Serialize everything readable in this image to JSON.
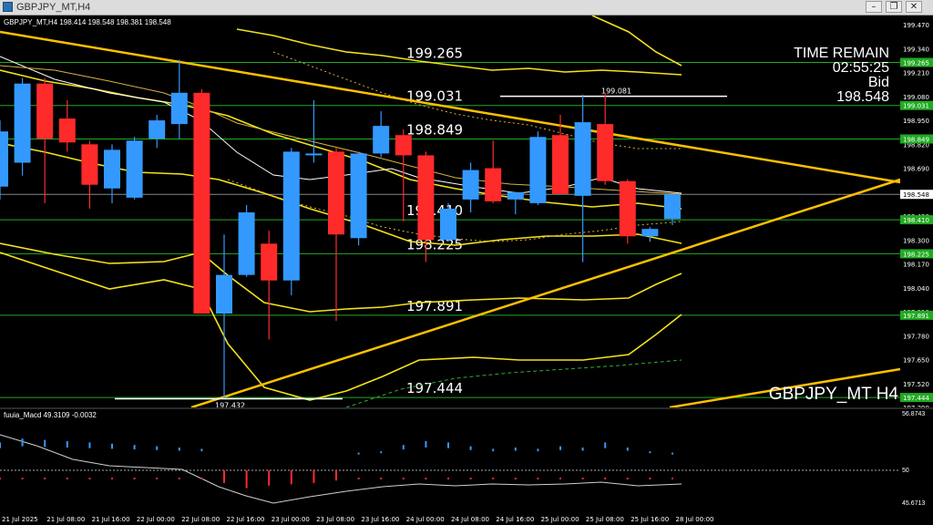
{
  "window": {
    "title": "GBPJPY_MT,H4"
  },
  "chart_header": "GBPJPY_MT,H4  198.414 198.548 198.381 198.548",
  "info": {
    "time_remain_label": "TIME REMAIN",
    "time_remain_value": "02:55:25",
    "bid_label": "Bid",
    "bid_value": "198.548",
    "watermark": "GBPJPY_MT H4"
  },
  "colors": {
    "bull": "#3399ff",
    "bear": "#ff2a2a",
    "level": "#22aa22",
    "trend": "#ffc000",
    "band": "#f3e21a",
    "bg": "#000000"
  },
  "chart_data": {
    "type": "candlestick",
    "y_range": [
      197.39,
      199.52
    ],
    "y_ticks": [
      "199.470",
      "199.340",
      "199.210",
      "199.080",
      "198.950",
      "198.820",
      "198.690",
      "198.560",
      "198.430",
      "198.300",
      "198.170",
      "198.040",
      "197.910",
      "197.780",
      "197.650",
      "197.520",
      "197.390"
    ],
    "level_tags": [
      "199.265",
      "199.031",
      "198.849",
      "198.410",
      "198.225",
      "197.891",
      "197.444"
    ],
    "current_price_tag": "198.548",
    "levels": [
      {
        "label": "199.265",
        "value": 199.265
      },
      {
        "label": "199.031",
        "value": 199.031
      },
      {
        "label": "198.849",
        "value": 198.849
      },
      {
        "label": "198.410",
        "value": 198.41
      },
      {
        "label": "198.225",
        "value": 198.225
      },
      {
        "label": "197.891",
        "value": 197.891
      },
      {
        "label": "197.444",
        "value": 197.444
      }
    ],
    "annotations": [
      {
        "text": "199.081",
        "value": 199.081
      },
      {
        "text": "197.432",
        "value": 197.432
      }
    ],
    "candles": [
      {
        "o": 198.59,
        "h": 198.95,
        "l": 198.52,
        "c": 198.89
      },
      {
        "o": 198.72,
        "h": 199.18,
        "l": 198.65,
        "c": 199.15
      },
      {
        "o": 199.15,
        "h": 199.18,
        "l": 198.5,
        "c": 198.85
      },
      {
        "o": 198.96,
        "h": 199.06,
        "l": 198.78,
        "c": 198.83
      },
      {
        "o": 198.82,
        "h": 198.84,
        "l": 198.47,
        "c": 198.6
      },
      {
        "o": 198.58,
        "h": 198.82,
        "l": 198.5,
        "c": 198.79
      },
      {
        "o": 198.53,
        "h": 198.86,
        "l": 198.52,
        "c": 198.84
      },
      {
        "o": 198.85,
        "h": 198.98,
        "l": 198.8,
        "c": 198.95
      },
      {
        "o": 198.93,
        "h": 199.28,
        "l": 198.85,
        "c": 199.1
      },
      {
        "o": 199.1,
        "h": 199.12,
        "l": 197.9,
        "c": 197.9
      },
      {
        "o": 197.9,
        "h": 198.33,
        "l": 197.44,
        "c": 198.11
      },
      {
        "o": 198.11,
        "h": 198.49,
        "l": 198.1,
        "c": 198.45
      },
      {
        "o": 198.28,
        "h": 198.35,
        "l": 197.76,
        "c": 198.08
      },
      {
        "o": 198.08,
        "h": 198.8,
        "l": 198.0,
        "c": 198.78
      },
      {
        "o": 198.76,
        "h": 199.06,
        "l": 198.72,
        "c": 198.77
      },
      {
        "o": 198.78,
        "h": 198.8,
        "l": 197.86,
        "c": 198.33
      },
      {
        "o": 198.31,
        "h": 198.78,
        "l": 198.27,
        "c": 198.77
      },
      {
        "o": 198.77,
        "h": 199.0,
        "l": 198.75,
        "c": 198.92
      },
      {
        "o": 198.87,
        "h": 198.9,
        "l": 198.4,
        "c": 198.76
      },
      {
        "o": 198.76,
        "h": 198.78,
        "l": 198.18,
        "c": 198.3
      },
      {
        "o": 198.3,
        "h": 198.5,
        "l": 198.29,
        "c": 198.47
      },
      {
        "o": 198.52,
        "h": 198.72,
        "l": 198.45,
        "c": 198.68
      },
      {
        "o": 198.69,
        "h": 198.84,
        "l": 198.5,
        "c": 198.51
      },
      {
        "o": 198.52,
        "h": 198.56,
        "l": 198.44,
        "c": 198.56
      },
      {
        "o": 198.5,
        "h": 198.89,
        "l": 198.49,
        "c": 198.86
      },
      {
        "o": 198.87,
        "h": 198.98,
        "l": 198.55,
        "c": 198.55
      },
      {
        "o": 198.54,
        "h": 199.09,
        "l": 198.18,
        "c": 198.94
      },
      {
        "o": 198.93,
        "h": 199.1,
        "l": 198.6,
        "c": 198.62
      },
      {
        "o": 198.62,
        "h": 198.63,
        "l": 198.28,
        "c": 198.32
      },
      {
        "o": 198.32,
        "h": 198.37,
        "l": 198.29,
        "c": 198.36
      },
      {
        "o": 198.414,
        "h": 198.548,
        "l": 198.381,
        "c": 198.548
      }
    ],
    "x_labels": [
      "21 Jul 2025",
      "21 Jul 08:00",
      "21 Jul 16:00",
      "22 Jul 00:00",
      "22 Jul 08:00",
      "22 Jul 16:00",
      "23 Jul 00:00",
      "23 Jul 08:00",
      "23 Jul 16:00",
      "24 Jul 00:00",
      "24 Jul 08:00",
      "24 Jul 16:00",
      "25 Jul 00:00",
      "25 Jul 08:00",
      "25 Jul 16:00",
      "28 Jul 00:00"
    ]
  },
  "indicator": {
    "label": "fuuia_Macd 49.3109 -0.0032",
    "axis_top": "56.8743",
    "axis_mid": "50",
    "axis_bottom": "45.6713",
    "hist": [
      0.45,
      0.6,
      0.55,
      0.5,
      0.45,
      0.4,
      0.35,
      0.3,
      0.25,
      0.2,
      -0.5,
      -0.7,
      -0.6,
      -0.55,
      -0.5,
      -0.4,
      0.05,
      0.1,
      0.35,
      0.5,
      0.45,
      0.3,
      0.2,
      0.25,
      0.2,
      0.3,
      0.25,
      0.45,
      0.25,
      0.1,
      0.05
    ]
  }
}
